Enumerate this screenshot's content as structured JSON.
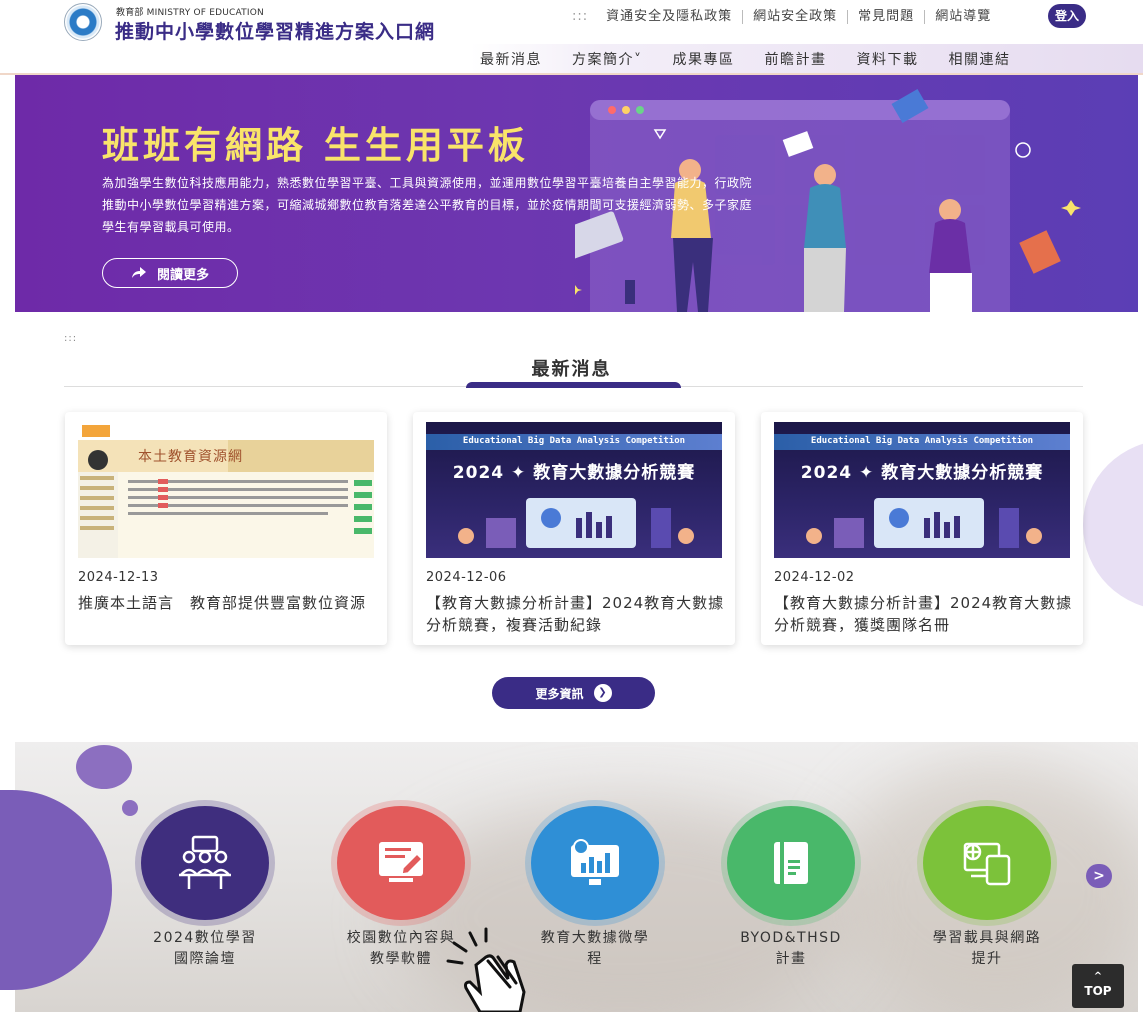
{
  "header": {
    "brand_sub": "教育部 MINISTRY OF EDUCATION",
    "brand_main": "推動中小學數位學習精進方案入口網",
    "util_dots": ":::",
    "util_links": [
      "資通安全及隱私政策",
      "網站安全政策",
      "常見問題",
      "網站導覽"
    ],
    "login": "登入"
  },
  "nav": {
    "items": [
      "最新消息",
      "方案簡介˅",
      "成果專區",
      "前瞻計畫",
      "資料下載",
      "相關連結"
    ]
  },
  "hero": {
    "title": "班班有網路 生生用平板",
    "desc": "為加強學生數位科技應用能力，熟悉數位學習平臺、工具與資源使用，並運用數位學習平臺培養自主學習能力，行政院推動中小學數位學習精進方案，可縮減城鄉數位教育落差達公平教育的目標，並於疫情期間可支援經濟弱勢、多子家庭學生有學習載具可使用。",
    "button": "閱讀更多"
  },
  "news": {
    "crumb": ":::",
    "title": "最新消息",
    "cards": [
      {
        "date": "2024-12-13",
        "title": "推廣本土語言　教育部提供豐富數位資源",
        "thumb_text": "本土教育資源網"
      },
      {
        "date": "2024-12-06",
        "title": "【教育大數據分析計畫】2024教育大數據分析競賽，複賽活動紀錄",
        "thumb_sub": "Educational Big Data Analysis Competition",
        "thumb_main": "2024 ✦ 教育大數據分析競賽"
      },
      {
        "date": "2024-12-02",
        "title": "【教育大數據分析計畫】2024教育大數據分析競賽，獲獎團隊名冊",
        "thumb_sub": "Educational Big Data Analysis Competition",
        "thumb_main": "2024 ✦ 教育大數據分析競賽"
      }
    ],
    "more": "更多資訊"
  },
  "services": [
    {
      "label_1": "2024數位學習",
      "label_2": "國際論壇",
      "color": "#3f2e7e"
    },
    {
      "label_1": "校園數位內容與",
      "label_2": "教學軟體",
      "color": "#e25b5b"
    },
    {
      "label_1": "教育大數據微學",
      "label_2": "程",
      "color": "#2f8fd6"
    },
    {
      "label_1": "BYOD&THSD",
      "label_2": "計畫",
      "color": "#49b86a"
    },
    {
      "label_1": "學習載具與網路",
      "label_2": "提升",
      "color": "#7cc23a"
    }
  ],
  "controls": {
    "next": ">",
    "top": "TOP",
    "top_caret": "^"
  }
}
